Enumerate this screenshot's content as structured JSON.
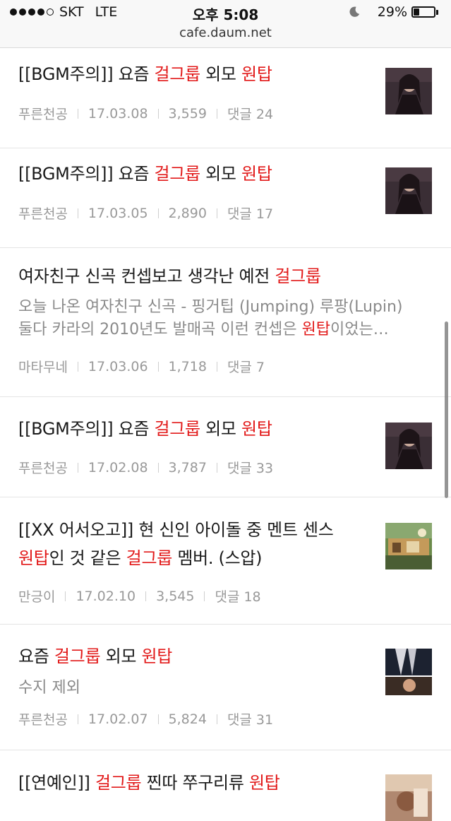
{
  "status_bar": {
    "carrier": "SKT",
    "network": "LTE",
    "time": "오후 5:08",
    "battery_percent": "29%",
    "battery_level": 0.29,
    "signal_bars": 4,
    "icons": [
      "signal-icon",
      "moon-icon",
      "battery-icon"
    ]
  },
  "url_bar": {
    "url": "cafe.daum.net"
  },
  "posts": [
    {
      "title_parts": [
        {
          "text": "[[BGM주의]] 요즘 ",
          "hl": false
        },
        {
          "text": "걸그룹",
          "hl": true
        },
        {
          "text": " 외모 ",
          "hl": false
        },
        {
          "text": "원탑",
          "hl": true
        }
      ],
      "author": "푸른천공",
      "date": "17.03.08",
      "views": "3,559",
      "comments": "댓글 24"
    },
    {
      "title_parts": [
        {
          "text": "[[BGM주의]] 요즘 ",
          "hl": false
        },
        {
          "text": "걸그룹",
          "hl": true
        },
        {
          "text": " 외모 ",
          "hl": false
        },
        {
          "text": "원탑",
          "hl": true
        }
      ],
      "author": "푸른천공",
      "date": "17.03.05",
      "views": "2,890",
      "comments": "댓글 17"
    },
    {
      "title_parts": [
        {
          "text": "여자친구 신곡 컨셉보고 생각난 예전 ",
          "hl": false
        },
        {
          "text": "걸그룹",
          "hl": true
        }
      ],
      "desc_line1": [
        {
          "text": "오늘 나온 여자친구 신곡 - 핑거팁 (Jumping) 루팡(Lupin)",
          "hl": false
        }
      ],
      "desc_line2": [
        {
          "text": "둘다 카라의 2010년도 발매곡 이런 컨셉은 ",
          "hl": false
        },
        {
          "text": "원탑",
          "hl": true
        },
        {
          "text": "이었는…",
          "hl": false
        }
      ],
      "author": "마타무네",
      "date": "17.03.06",
      "views": "1,718",
      "comments": "댓글 7"
    },
    {
      "title_parts": [
        {
          "text": "[[BGM주의]] 요즘 ",
          "hl": false
        },
        {
          "text": "걸그룹",
          "hl": true
        },
        {
          "text": " 외모 ",
          "hl": false
        },
        {
          "text": "원탑",
          "hl": true
        }
      ],
      "author": "푸른천공",
      "date": "17.02.08",
      "views": "3,787",
      "comments": "댓글 33"
    },
    {
      "title_parts": [
        {
          "text": "[[XX 어서오고]] 현 신인 아이돌 중 멘트 센스",
          "hl": false
        }
      ],
      "title_parts_line2": [
        {
          "text": "원탑",
          "hl": true
        },
        {
          "text": "인 것 같은 ",
          "hl": false
        },
        {
          "text": "걸그룹",
          "hl": true
        },
        {
          "text": " 멤버. (스압)",
          "hl": false
        }
      ],
      "author": "만긍이",
      "date": "17.02.10",
      "views": "3,545",
      "comments": "댓글 18"
    },
    {
      "title_parts": [
        {
          "text": "요즘 ",
          "hl": false
        },
        {
          "text": "걸그룹",
          "hl": true
        },
        {
          "text": " 외모 ",
          "hl": false
        },
        {
          "text": "원탑",
          "hl": true
        }
      ],
      "desc_line1": [
        {
          "text": "수지 제외",
          "hl": false
        }
      ],
      "author": "푸른천공",
      "date": "17.02.07",
      "views": "5,824",
      "comments": "댓글 31"
    },
    {
      "title_parts": [
        {
          "text": "[[연예인]] ",
          "hl": false
        },
        {
          "text": "걸그룹",
          "hl": true
        },
        {
          "text": " 찐따 쭈구리류 ",
          "hl": false
        },
        {
          "text": "원탑",
          "hl": true
        }
      ]
    }
  ],
  "colors": {
    "highlight": "#e21a1a",
    "meta": "#999999",
    "title": "#1a1a1a"
  }
}
